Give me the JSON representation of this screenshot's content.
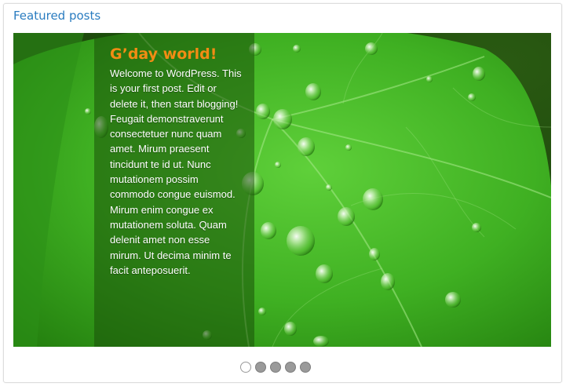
{
  "widget": {
    "title": "Featured posts"
  },
  "slider": {
    "image_subject": "green leaf with water droplets",
    "caption": {
      "title": "G’day world!",
      "text": "Welcome to WordPress. This is your first post. Edit or delete it, then start blogging! Feugait demonstraverunt consectetuer nunc quam amet. Mirum praesent tincidunt te id ut. Nunc mutationem possim commodo congue euismod. Mirum enim congue ex mutationem soluta. Quam delenit amet non esse mirum. Ut decima minim te facit anteposuerit."
    },
    "pager": {
      "count": 5,
      "active_index": 0
    }
  },
  "colors": {
    "title_blue": "#2a7cc0",
    "caption_title_orange": "#f28c14",
    "leaf_green": "#3aa51e"
  }
}
